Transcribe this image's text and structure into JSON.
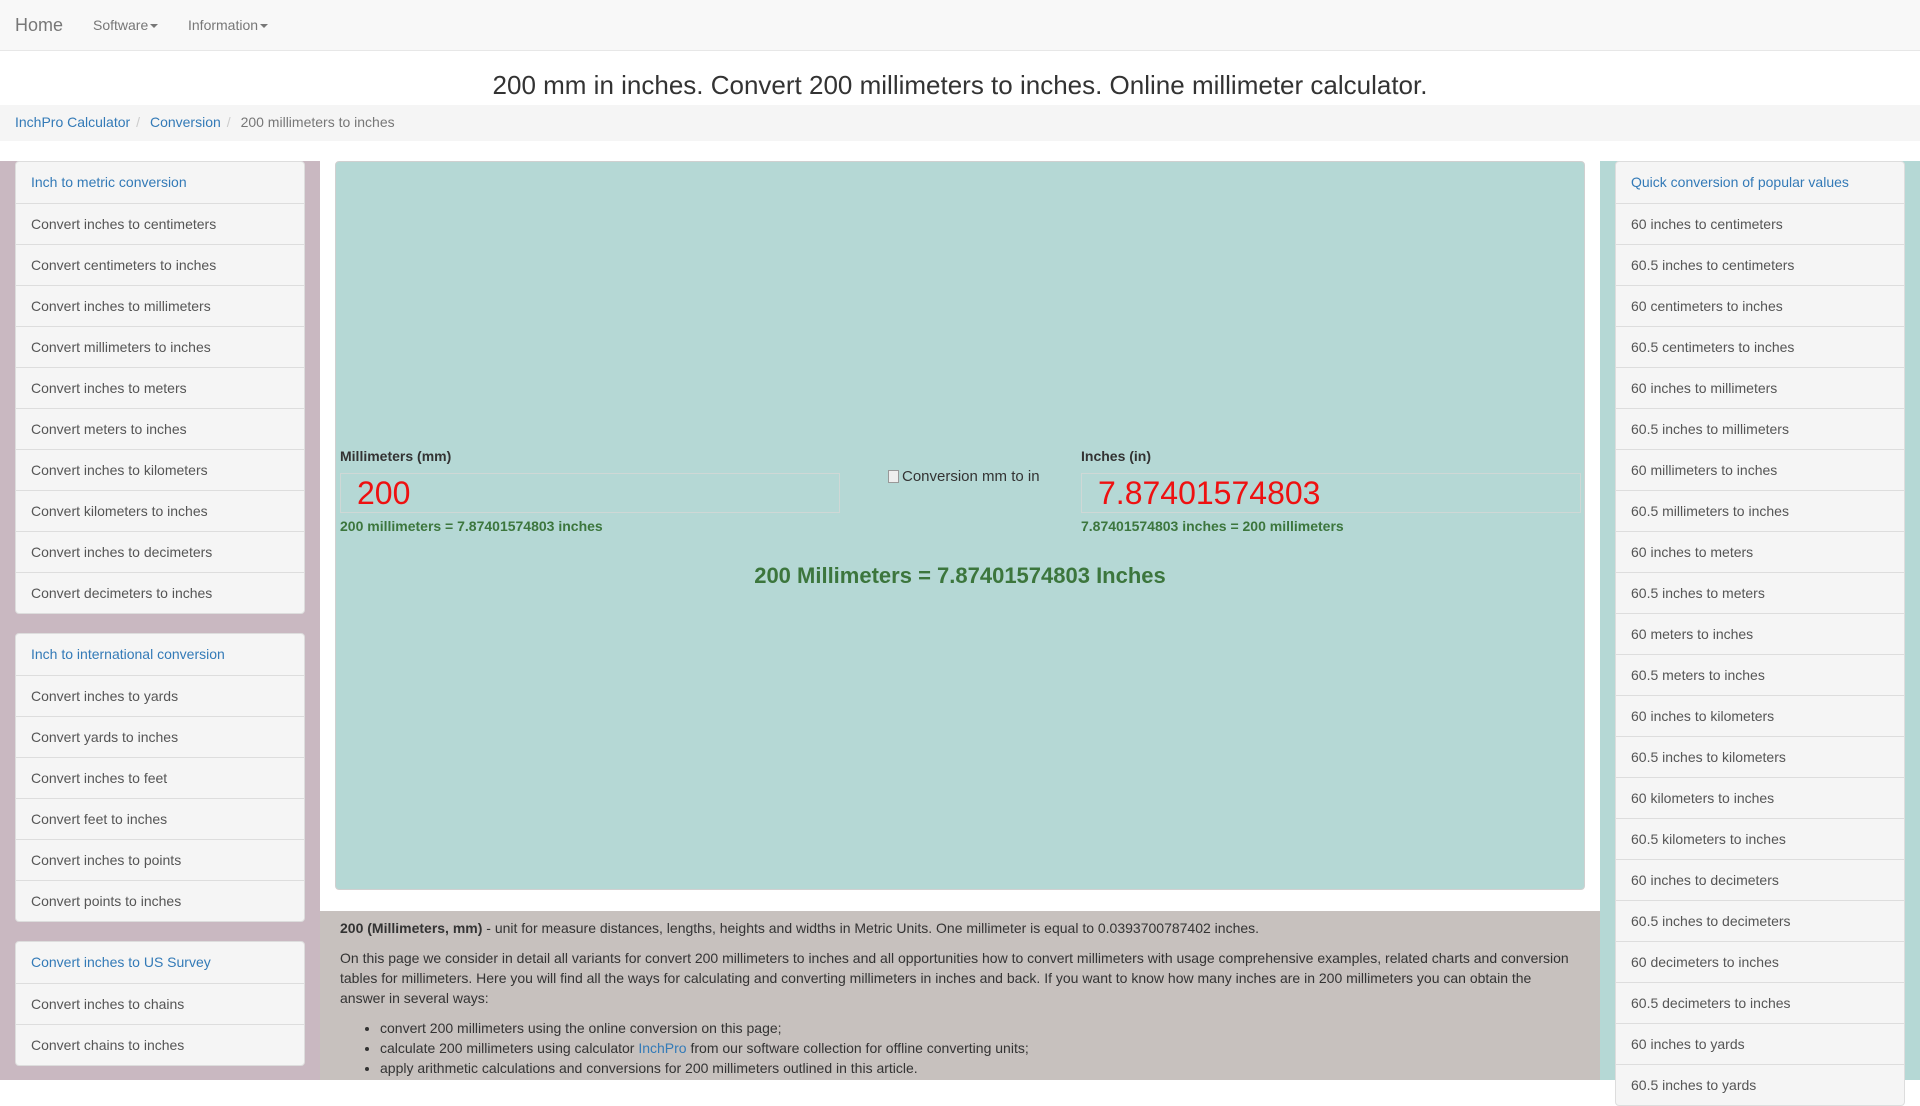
{
  "navbar": {
    "brand": "Home",
    "menu": [
      {
        "label": "Software"
      },
      {
        "label": "Information"
      }
    ]
  },
  "page_title": "200 mm in inches. Convert 200 millimeters to inches. Online millimeter calculator.",
  "breadcrumb": [
    "InchPro Calculator",
    "Conversion",
    "200 millimeters to inches"
  ],
  "left_sidebar": {
    "groups": [
      {
        "header": "Inch to metric conversion",
        "items": [
          "Convert inches to centimeters",
          "Convert centimeters to inches",
          "Convert inches to millimeters",
          "Convert millimeters to inches",
          "Convert inches to meters",
          "Convert meters to inches",
          "Convert inches to kilometers",
          "Convert kilometers to inches",
          "Convert inches to decimeters",
          "Convert decimeters to inches"
        ]
      },
      {
        "header": "Inch to international conversion",
        "items": [
          "Convert inches to yards",
          "Convert yards to inches",
          "Convert inches to feet",
          "Convert feet to inches",
          "Convert inches to points",
          "Convert points to inches"
        ]
      },
      {
        "header": "Convert inches to US Survey",
        "items": [
          "Convert inches to chains",
          "Convert chains to inches"
        ]
      }
    ]
  },
  "converter": {
    "left_label": "Millimeters (mm)",
    "left_value": "200",
    "left_hint": "200 millimeters = 7.87401574803 inches",
    "image_alt": "Conversion mm to in",
    "right_label": "Inches (in)",
    "right_value": "7.87401574803",
    "right_hint": "7.87401574803 inches = 200 millimeters",
    "result": "200 Millimeters = 7.87401574803 Inches"
  },
  "article": {
    "intro_bold": "200 (Millimeters, mm)",
    "intro_rest": " - unit for measure distances, lengths, heights and widths in Metric Units. One millimeter is equal to 0.0393700787402 inches.",
    "paragraph": "On this page we consider in detail all variants for convert 200 millimeters to inches and all opportunities how to convert millimeters with usage comprehensive examples, related charts and conversion tables for millimeters. Here you will find all the ways for calculating and converting millimeters in inches and back. If you want to know how many inches are in 200 millimeters you can obtain the answer in several ways:",
    "bullet1": "convert 200 millimeters using the online conversion on this page;",
    "bullet2_pre": "calculate 200 millimeters using calculator ",
    "bullet2_link": "InchPro",
    "bullet2_post": " from our software collection for offline converting units;",
    "bullet3": "apply arithmetic calculations and conversions for 200 millimeters outlined in this article."
  },
  "right_sidebar": {
    "header": "Quick conversion of popular values",
    "items": [
      "60 inches to centimeters",
      "60.5 inches to centimeters",
      "60 centimeters to inches",
      "60.5 centimeters to inches",
      "60 inches to millimeters",
      "60.5 inches to millimeters",
      "60 millimeters to inches",
      "60.5 millimeters to inches",
      "60 inches to meters",
      "60.5 inches to meters",
      "60 meters to inches",
      "60.5 meters to inches",
      "60 inches to kilometers",
      "60.5 inches to kilometers",
      "60 kilometers to inches",
      "60.5 kilometers to inches",
      "60 inches to decimeters",
      "60.5 inches to decimeters",
      "60 decimeters to inches",
      "60.5 decimeters to inches",
      "60 inches to yards",
      "60.5 inches to yards"
    ]
  },
  "colors": {
    "panel_teal": "#b5d8d5",
    "sidebar_mauve": "#c9b8c1",
    "result_green": "#3c763d",
    "value_red": "#ee1111",
    "link_blue": "#337ab7"
  }
}
